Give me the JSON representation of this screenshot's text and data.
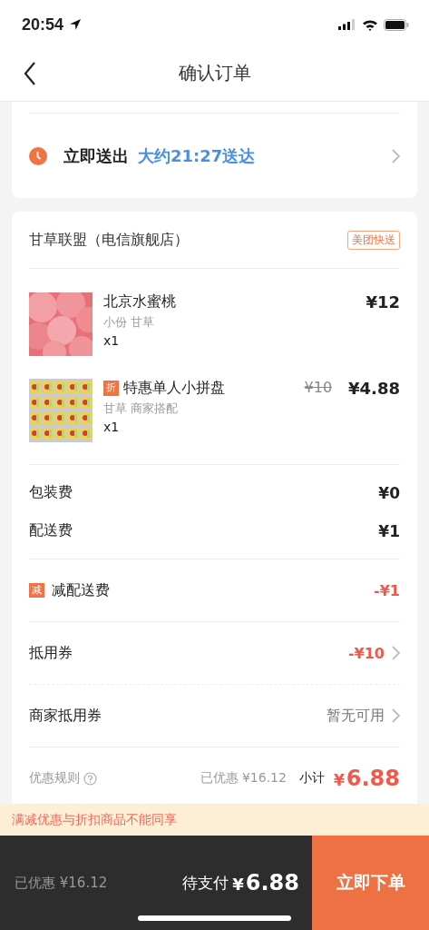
{
  "status_bar": {
    "time": "20:54"
  },
  "nav": {
    "title": "确认订单"
  },
  "delivery": {
    "label": "立即送出",
    "eta": "大约21:27送达"
  },
  "store": {
    "name": "甘草联盟（电信旗舰店）",
    "badge": "美团快送"
  },
  "items": [
    {
      "kind": "picture",
      "name": "北京水蜜桃",
      "spec": "小份 甘草",
      "qty": "x1",
      "price": "¥12"
    },
    {
      "kind": "picture",
      "tag": "折",
      "name": "特惠单人小拼盘",
      "spec": "甘草 商家搭配",
      "qty": "x1",
      "original_price": "¥10",
      "price": "¥4.88"
    }
  ],
  "fees": [
    {
      "label": "包装费",
      "value": "¥0"
    },
    {
      "label": "配送费",
      "value": "¥1"
    }
  ],
  "discount": {
    "tag": "减",
    "label": "减配送费",
    "value": "-¥1"
  },
  "coupons": [
    {
      "kind": "applied",
      "label": "抵用券",
      "value": "-¥10"
    },
    {
      "kind": "none",
      "label": "商家抵用券",
      "value": "暂无可用"
    }
  ],
  "subtotal": {
    "rules": "优惠规则",
    "saved": "已优惠 ¥16.12",
    "label": "小计",
    "currency": "¥",
    "amount": "6.88"
  },
  "notice": "满减优惠与折扣商品不能同享",
  "bottom_bar": {
    "saved": "已优惠 ¥16.12",
    "pay_label": "待支付",
    "currency": "¥",
    "amount": "6.88",
    "submit": "立即下单"
  }
}
